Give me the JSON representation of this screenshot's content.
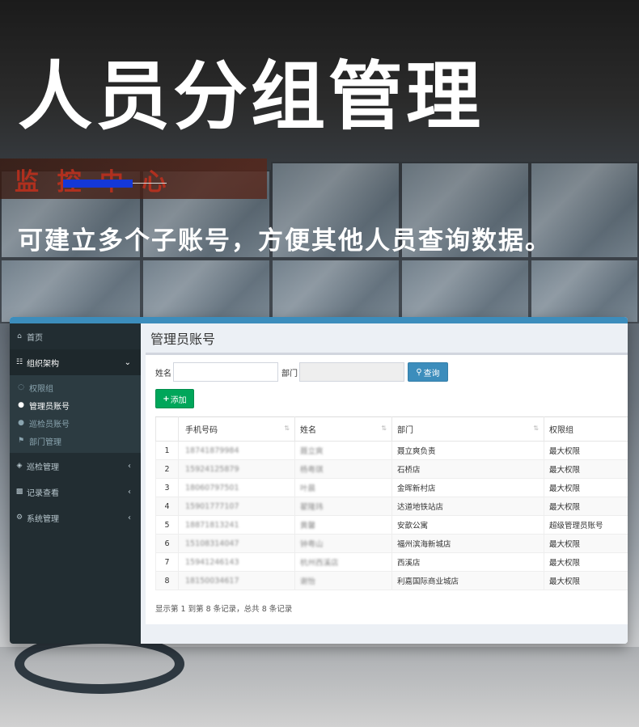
{
  "hero": {
    "title": "人员分组管理",
    "subtitle": "可建立多个子账号，方便其他人员查询数据。"
  },
  "background": {
    "led_text": "监 控 中 心"
  },
  "sidebar": {
    "items": [
      {
        "icon": "home-icon",
        "label": "首页"
      },
      {
        "icon": "sitemap-icon",
        "label": "组织架构",
        "expanded": true
      },
      {
        "icon": "eye-icon",
        "label": "巡检管理"
      },
      {
        "icon": "bar-chart-icon",
        "label": "记录查看"
      },
      {
        "icon": "gear-icon",
        "label": "系统管理"
      }
    ],
    "submenu": [
      {
        "icon": "unlock-icon",
        "label": "权限组"
      },
      {
        "icon": "user-icon",
        "label": "管理员账号",
        "current": true
      },
      {
        "icon": "user-icon",
        "label": "巡检员账号"
      },
      {
        "icon": "bank-icon",
        "label": "部门管理"
      }
    ]
  },
  "page": {
    "title": "管理员账号",
    "filter": {
      "name_label": "姓名",
      "dept_label": "部门",
      "name_value": "",
      "dept_value": "",
      "query_button": "查询"
    },
    "add_button": "添加"
  },
  "table": {
    "columns": [
      "",
      "手机号码",
      "姓名",
      "部门",
      "权限组"
    ],
    "rows": [
      {
        "idx": "1",
        "phone": "18741879984",
        "name": "聂立爽",
        "dept": "聂立爽负责",
        "group": "最大权限"
      },
      {
        "idx": "2",
        "phone": "15924125879",
        "name": "杨粤琪",
        "dept": "石桥店",
        "group": "最大权限"
      },
      {
        "idx": "3",
        "phone": "18060797501",
        "name": "叶晨",
        "dept": "金晖新村店",
        "group": "最大权限"
      },
      {
        "idx": "4",
        "phone": "15901777107",
        "name": "翟隆玮",
        "dept": "达道地铁站店",
        "group": "最大权限"
      },
      {
        "idx": "5",
        "phone": "18871813241",
        "name": "黄馨",
        "dept": "安歆公寓",
        "group": "超级管理员账号"
      },
      {
        "idx": "6",
        "phone": "15108314047",
        "name": "钟粤山",
        "dept": "福州滨海新城店",
        "group": "最大权限"
      },
      {
        "idx": "7",
        "phone": "15941246143",
        "name": "杭州西溪店",
        "dept": "西溪店",
        "group": "最大权限"
      },
      {
        "idx": "8",
        "phone": "18150034617",
        "name": "谢怡",
        "dept": "利嘉国际商业城店",
        "group": "最大权限"
      }
    ],
    "footer": "显示第 1 到第 8 条记录，总共 8 条记录"
  },
  "colors": {
    "sidebar": "#222d32",
    "header": "#3c8dbc",
    "add": "#00a65a",
    "accent": "#1438d8"
  }
}
